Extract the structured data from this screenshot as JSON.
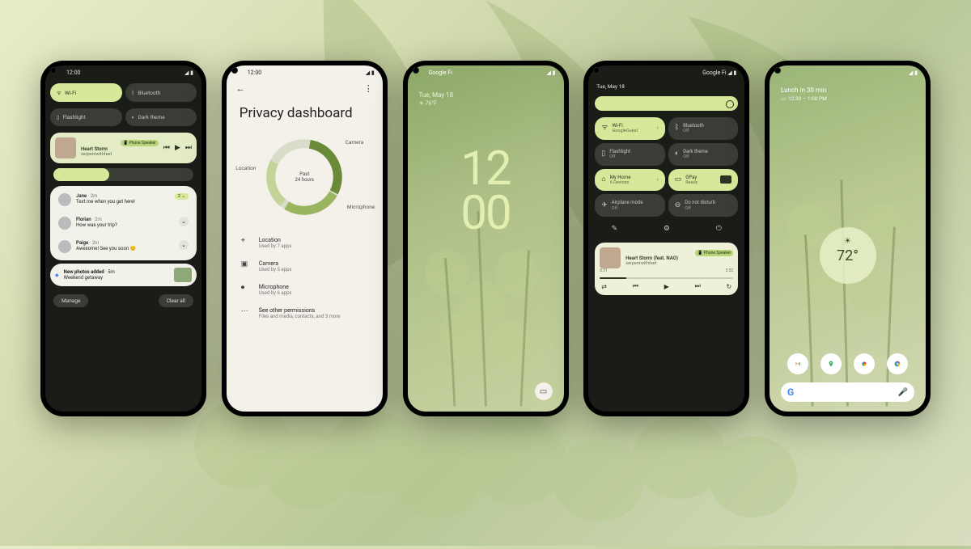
{
  "statusbar": {
    "time": "12:00",
    "carrier": "Google Fi"
  },
  "phone1": {
    "qs": [
      {
        "label": "Wi-Fi",
        "on": true
      },
      {
        "label": "Bluetooth",
        "on": false
      },
      {
        "label": "Flashlight",
        "on": false
      },
      {
        "label": "Dark theme",
        "on": false
      }
    ],
    "media": {
      "title": "Heart Storm",
      "artist": "serpentwithfeet",
      "device": "Phone Speaker"
    },
    "notifs": [
      {
        "who": "Jane",
        "meta": "2m",
        "text": "Text me when you get here!",
        "badge": "2"
      },
      {
        "who": "Florian",
        "meta": "2m",
        "text": "How was your trip?"
      },
      {
        "who": "Paige",
        "meta": "2m",
        "text": "Awesome! See you soon 😊"
      }
    ],
    "photonotif": {
      "title": "New photos added",
      "meta": "5m",
      "text": "Weekend getaway"
    },
    "actions": {
      "manage": "Manage",
      "clear": "Clear all"
    }
  },
  "phone2": {
    "title": "Privacy dashboard",
    "donut": {
      "center_top": "Past",
      "center_bottom": "24 hours",
      "labels": {
        "camera": "Camera",
        "location": "Location",
        "microphone": "Microphone"
      }
    },
    "perms": [
      {
        "icon": "pin",
        "name": "Location",
        "sub": "Used by 7 apps"
      },
      {
        "icon": "camera",
        "name": "Camera",
        "sub": "Used by 5 apps"
      },
      {
        "icon": "mic",
        "name": "Microphone",
        "sub": "Used by 6 apps"
      },
      {
        "icon": "more",
        "name": "See other permissions",
        "sub": "Files and media, contacts, and 3 more"
      }
    ]
  },
  "phone3": {
    "date": "Tue, May 18",
    "weather": "76°F",
    "clock_top": "12",
    "clock_bottom": "00"
  },
  "phone4": {
    "date": "Tue, May 18",
    "tiles": [
      {
        "name": "Wi-Fi",
        "sub": "GoogleGuest",
        "on": true,
        "chev": true
      },
      {
        "name": "Bluetooth",
        "sub": "Off",
        "on": false
      },
      {
        "name": "Flashlight",
        "sub": "Off",
        "on": false
      },
      {
        "name": "Dark theme",
        "sub": "Off",
        "on": false
      },
      {
        "name": "My Home",
        "sub": "6 Devices",
        "on": true,
        "chev": true
      },
      {
        "name": "GPay",
        "sub": "Ready",
        "on": true,
        "card": true
      },
      {
        "name": "Airplane mode",
        "sub": "Off",
        "on": false
      },
      {
        "name": "Do not disturb",
        "sub": "Off",
        "on": false
      }
    ],
    "media": {
      "title": "Heart Storm (feat. NAO)",
      "artist": "serpentwithfeet",
      "device": "Phone Speaker",
      "elapsed": "0:31",
      "total": "3:32"
    }
  },
  "phone5": {
    "glance": {
      "title": "Lunch in 30 min",
      "sub": "12:30 – 1:00 PM"
    },
    "temp": "72°",
    "apps": [
      "gmail",
      "maps",
      "photos",
      "chrome"
    ]
  }
}
